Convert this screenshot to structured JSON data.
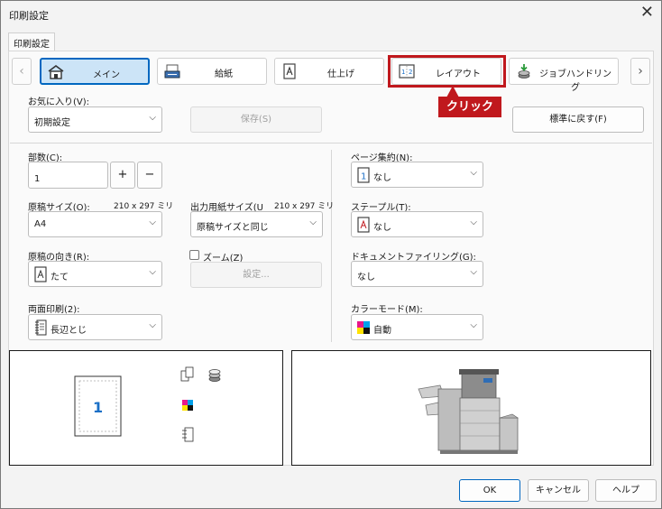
{
  "window": {
    "title": "印刷設定",
    "close_glyph": "✕"
  },
  "tabstrip": {
    "active_tab": "印刷設定"
  },
  "ribbon": {
    "prev_glyph": "‹",
    "next_glyph": "›",
    "tabs": [
      {
        "label": "メイン",
        "icon": "home-icon",
        "selected": true
      },
      {
        "label": "給紙",
        "icon": "paper-tray-icon",
        "selected": false
      },
      {
        "label": "仕上げ",
        "icon": "finishing-icon",
        "selected": false
      },
      {
        "label": "レイアウト",
        "icon": "layout-icon",
        "selected": false
      },
      {
        "label": "ジョブハンドリング",
        "icon": "job-handling-icon",
        "selected": false
      }
    ]
  },
  "callout": {
    "text": "クリック",
    "color": "#c0181d"
  },
  "favorites": {
    "label": "お気に入り(V):",
    "value": "初期設定",
    "save_label": "保存(S)",
    "reset_label": "標準に戻す(F)"
  },
  "copies": {
    "label": "部数(C):",
    "value": "1",
    "plus": "+",
    "minus": "−"
  },
  "original_size": {
    "label": "原稿サイズ(O):",
    "dimension": "210 x 297 ミリ",
    "value": "A4"
  },
  "output_size": {
    "label": "出力用紙サイズ(U",
    "dimension": "210 x 297 ミリ",
    "value": "原稿サイズと同じ"
  },
  "orientation": {
    "label": "原稿の向き(R):",
    "value": "たて",
    "icon": "portrait-page-icon"
  },
  "zoom": {
    "label": "ズーム(Z)",
    "checked": false,
    "settings_label": "設定..."
  },
  "duplex": {
    "label": "両面印刷(2):",
    "value": "長辺とじ",
    "icon": "long-edge-binding-icon"
  },
  "n_up": {
    "label": "ページ集約(N):",
    "value": "なし",
    "icon": "one-up-icon"
  },
  "staple": {
    "label": "ステープル(T):",
    "value": "なし",
    "icon": "no-staple-icon"
  },
  "doc_filing": {
    "label": "ドキュメントファイリング(G):",
    "value": "なし"
  },
  "color_mode": {
    "label": "カラーモード(M):",
    "value": "自動",
    "icon": "color-auto-icon"
  },
  "preview": {
    "page_number": "1"
  },
  "footer": {
    "ok": "OK",
    "cancel": "キャンセル",
    "help": "ヘルプ"
  },
  "colors": {
    "accent": "#0067c0",
    "selected_tab_bg": "#cce4f7",
    "callout": "#c0181d"
  }
}
